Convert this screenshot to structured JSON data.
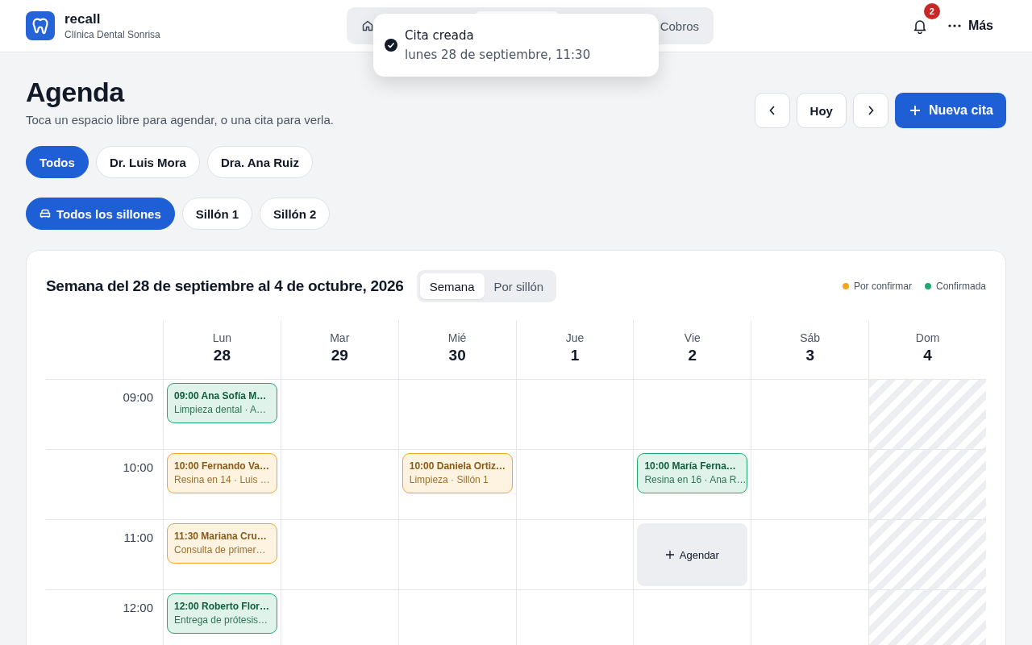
{
  "brand": {
    "name": "recall",
    "subtitle": "Clínica Dental Sonrisa"
  },
  "nav": [
    {
      "kind": "home",
      "selected": false
    },
    {
      "kind": "blank",
      "selected": true
    },
    {
      "kind": "text",
      "label": "Cobros",
      "selected": false
    }
  ],
  "notifications": {
    "count": "2"
  },
  "more": {
    "label": "Más"
  },
  "toast": {
    "title": "Cita creada",
    "message": "lunes 28 de septiembre, 11:30"
  },
  "page": {
    "title": "Agenda",
    "subtitle": "Toca un espacio libre para agendar, o una cita para verla."
  },
  "actions": {
    "today": "Hoy",
    "new": "Nueva cita"
  },
  "dentists": [
    {
      "label": "Todos",
      "selected": true
    },
    {
      "label": "Dr. Luis Mora",
      "selected": false
    },
    {
      "label": "Dra. Ana Ruiz",
      "selected": false
    }
  ],
  "chairs": [
    {
      "label": "Todos los sillones",
      "selected": true
    },
    {
      "label": "Sillón 1",
      "selected": false
    },
    {
      "label": "Sillón 2",
      "selected": false
    }
  ],
  "calendar": {
    "title": "Semana del 28 de septiembre al 4 de octubre, 2026",
    "views": [
      {
        "label": "Semana",
        "selected": true
      },
      {
        "label": "Por sillón",
        "selected": false
      }
    ],
    "legend": [
      {
        "label": "Por confirmar",
        "color": "#f5a524"
      },
      {
        "label": "Confirmada",
        "color": "#1fa971"
      }
    ],
    "days": [
      {
        "name": "Lun",
        "date": "28"
      },
      {
        "name": "Mar",
        "date": "29"
      },
      {
        "name": "Mié",
        "date": "30"
      },
      {
        "name": "Jue",
        "date": "1"
      },
      {
        "name": "Vie",
        "date": "2"
      },
      {
        "name": "Sáb",
        "date": "3"
      },
      {
        "name": "Dom",
        "date": "4"
      }
    ],
    "rows": [
      {
        "time": "09:00",
        "cells": [
          {
            "kind": "event",
            "color": "#1fa971",
            "title": "09:00 Ana Sofía M…",
            "detail": "Limpieza dental · A…"
          },
          {
            "kind": "empty"
          },
          {
            "kind": "empty"
          },
          {
            "kind": "empty"
          },
          {
            "kind": "empty"
          },
          {
            "kind": "empty"
          },
          {
            "kind": "closed"
          }
        ]
      },
      {
        "time": "10:00",
        "cells": [
          {
            "kind": "event",
            "color": "#f5a524",
            "title": "10:00 Fernando Va…",
            "detail": "Resina en 14 · Luis …"
          },
          {
            "kind": "empty"
          },
          {
            "kind": "event",
            "color": "#f5a524",
            "title": "10:00 Daniela Ortiz…",
            "detail": "Limpieza · Sillón 1"
          },
          {
            "kind": "empty"
          },
          {
            "kind": "event",
            "color": "#1fa971",
            "title": "10:00 María Ferna…",
            "detail": "Resina en 16 · Ana R…"
          },
          {
            "kind": "empty"
          },
          {
            "kind": "closed"
          }
        ]
      },
      {
        "time": "11:00",
        "cells": [
          {
            "kind": "event",
            "color": "#f5a524",
            "title": "11:30 Mariana Cru…",
            "detail": "Consulta de primer…"
          },
          {
            "kind": "empty"
          },
          {
            "kind": "empty"
          },
          {
            "kind": "empty"
          },
          {
            "kind": "slot",
            "label": "Agendar"
          },
          {
            "kind": "empty"
          },
          {
            "kind": "closed"
          }
        ]
      },
      {
        "time": "12:00",
        "cells": [
          {
            "kind": "event",
            "color": "#1fa971",
            "title": "12:00 Roberto Flor…",
            "detail": "Entrega de prótesis…"
          },
          {
            "kind": "empty"
          },
          {
            "kind": "empty"
          },
          {
            "kind": "empty"
          },
          {
            "kind": "empty"
          },
          {
            "kind": "empty"
          },
          {
            "kind": "closed"
          }
        ]
      }
    ]
  }
}
